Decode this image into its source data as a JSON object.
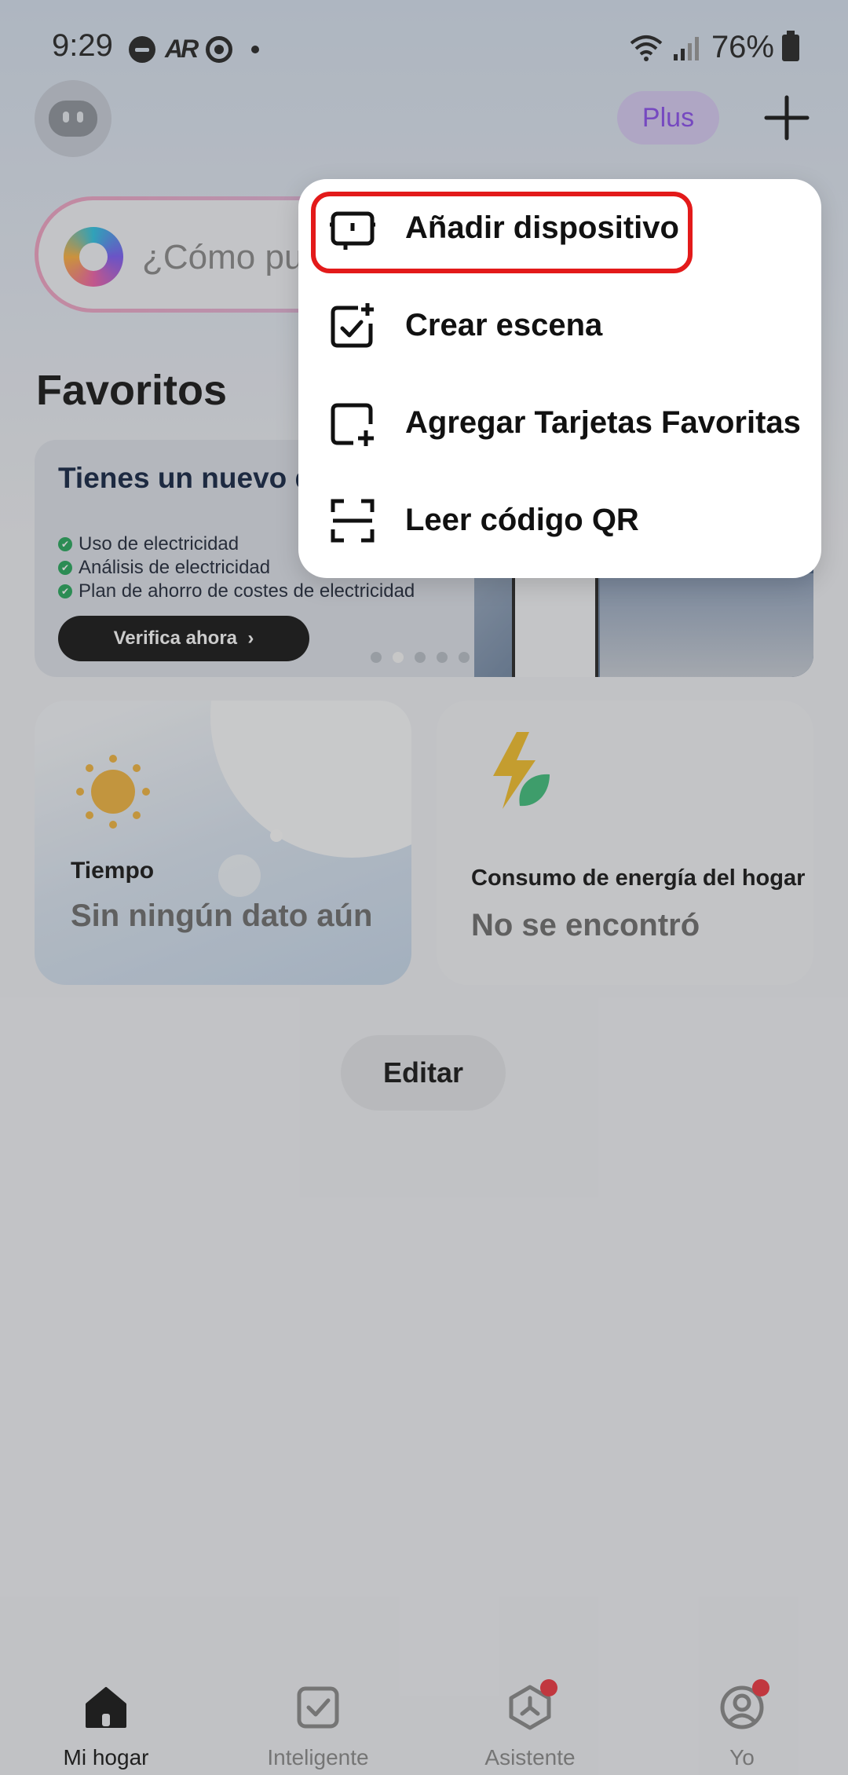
{
  "status_bar": {
    "time": "9:29",
    "ar_label": "AR",
    "battery": "76%"
  },
  "header": {
    "plus_label": "Plus"
  },
  "assistant_bar": {
    "placeholder": "¿Cómo pue"
  },
  "favorites": {
    "title": "Favoritos"
  },
  "banner": {
    "title": "Tienes un nuevo de energía:",
    "items": [
      "Uso de electricidad",
      "Análisis de electricidad",
      "Plan de ahorro de costes de electricidad"
    ],
    "button": "Verifica ahora",
    "page_count": 5,
    "active_page": 2
  },
  "weather_card": {
    "label": "Tiempo",
    "value": "Sin ningún dato aún"
  },
  "energy_card": {
    "label": "Consumo de energía del hogar",
    "value": "No se encontró"
  },
  "edit_button": "Editar",
  "menu": {
    "items": [
      {
        "label": "Añadir dispositivo",
        "icon": "add-device-icon",
        "highlighted": true
      },
      {
        "label": "Crear escena",
        "icon": "create-scene-icon"
      },
      {
        "label": "Agregar Tarjetas Favoritas",
        "icon": "add-card-icon"
      },
      {
        "label": "Leer código QR",
        "icon": "qr-scan-icon"
      }
    ]
  },
  "bottom_nav": [
    {
      "label": "Mi hogar",
      "active": true,
      "badge": false
    },
    {
      "label": "Inteligente",
      "active": false,
      "badge": false
    },
    {
      "label": "Asistente",
      "active": false,
      "badge": true
    },
    {
      "label": "Yo",
      "active": false,
      "badge": true
    }
  ],
  "colors": {
    "accent_purple": "#8a4cf0",
    "highlight_red": "#e31a1a",
    "badge_red": "#f2333d"
  }
}
